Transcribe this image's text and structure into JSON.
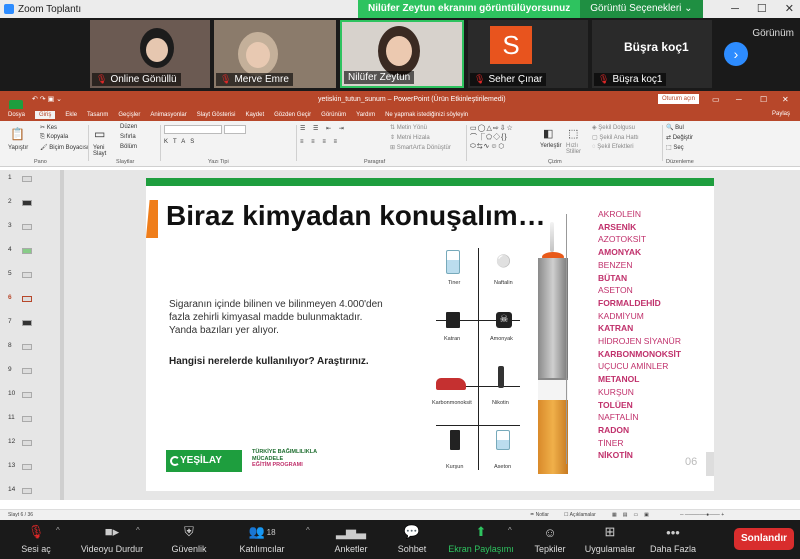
{
  "window": {
    "title": "Zoom Toplantı"
  },
  "share_banner": {
    "status": "Nilüfer Zeytun ekranını görüntülüyorsunuz",
    "options": "Görüntü Seçenekleri"
  },
  "gallery": {
    "participants": [
      {
        "name": "Online Gönüllü"
      },
      {
        "name": "Merve Emre"
      },
      {
        "name": "Nilüfer Zeytun"
      },
      {
        "name": "Seher Çınar",
        "initial": "S"
      },
      {
        "name": "Büşra koç1",
        "label": "Büşra koç1"
      }
    ],
    "view_label": "Görünüm"
  },
  "ppt": {
    "filename": "yetiskin_tutun_sunum  –  PowerPoint (Ürün Etkinleştirilemedi)",
    "signin": "Oturum açın",
    "tabs": [
      "Dosya",
      "Giriş",
      "Ekle",
      "Tasarım",
      "Geçişler",
      "Animasyonlar",
      "Slayt Gösterisi",
      "Kaydet",
      "Gözden Geçir",
      "Görünüm",
      "Yardım",
      "Ne yapmak istediğinizi söyleyin"
    ],
    "share": "Paylaş",
    "ribbon": {
      "clipboard": {
        "paste": "Yapıştır",
        "cut": "Kes",
        "copy": "Kopyala",
        "format": "Biçim Boyacısı",
        "group": "Pano"
      },
      "slides": {
        "new": "Yeni Slayt",
        "layout": "Düzen",
        "reset": "Sıfırla",
        "section": "Bölüm",
        "group": "Slaytlar"
      },
      "font_group": "Yazı Tipi",
      "paragraph": {
        "dir": "Metin Yönü",
        "align": "Metni Hizala",
        "smartart": "SmartArt'a Dönüştür",
        "group": "Paragraf"
      },
      "drawing": {
        "arrange": "Yerleştir",
        "styles": "Hızlı Stiller",
        "fill": "Şekil Dolgusu",
        "outline": "Şekil Ana Hattı",
        "effects": "Şekil Efektleri",
        "group": "Çizim"
      },
      "editing": {
        "find": "Bul",
        "replace": "Değiştir",
        "select": "Seç",
        "group": "Düzenleme"
      }
    },
    "slide_numbers": [
      "1",
      "2",
      "3",
      "4",
      "5",
      "6",
      "7",
      "8",
      "9",
      "10",
      "11",
      "12",
      "13",
      "14"
    ],
    "status": {
      "slide": "Slayt 6 / 36",
      "notes": "Notlar",
      "comments": "Açıklamalar"
    }
  },
  "slide": {
    "title": "Biraz kimyadan konuşalım…",
    "paragraph": "Sigaranın içinde bilinen ve bilinmeyen 4.000'den fazla zehirli kimyasal madde bulunmaktadır. Yanda bazıları yer alıyor.",
    "question": "Hangisi nerelerde kullanılıyor? Araştırınız.",
    "icons": [
      "Tiner",
      "Naftalin",
      "Katran",
      "Amonyak",
      "Karbonmonoksit",
      "Nikotin",
      "Kurşun",
      "Aseton"
    ],
    "chemicals": [
      {
        "name": "AKROLEİN",
        "bold": false
      },
      {
        "name": "ARSENİK",
        "bold": true
      },
      {
        "name": "AZOTOKSİT",
        "bold": false
      },
      {
        "name": "AMONYAK",
        "bold": true
      },
      {
        "name": "BENZEN",
        "bold": false
      },
      {
        "name": "BÜTAN",
        "bold": true
      },
      {
        "name": "ASETON",
        "bold": false
      },
      {
        "name": "FORMALDEHİD",
        "bold": true
      },
      {
        "name": "KADMİYUM",
        "bold": false
      },
      {
        "name": "KATRAN",
        "bold": true
      },
      {
        "name": "HİDROJEN SİYANÜR",
        "bold": false
      },
      {
        "name": "KARBONMONOKSİT",
        "bold": true
      },
      {
        "name": "UÇUCU AMİNLER",
        "bold": false
      },
      {
        "name": "METANOL",
        "bold": true
      },
      {
        "name": "KURŞUN",
        "bold": false
      },
      {
        "name": "TOLÜEN",
        "bold": true
      },
      {
        "name": "NAFTALİN",
        "bold": false
      },
      {
        "name": "RADON",
        "bold": true
      },
      {
        "name": "TİNER",
        "bold": false
      },
      {
        "name": "NİKOTİN",
        "bold": true
      }
    ],
    "logo": "YEŞİLAY",
    "program_line1": "TÜRKİYE BAĞIMLILIKLA",
    "program_line2": "MÜCADELE",
    "program_line3": "EĞİTİM PROGRAMI",
    "page_number": "06"
  },
  "toolbar": {
    "unmute": "Sesi aç",
    "video": "Videoyu Durdur",
    "security": "Güvenlik",
    "participants": "Katılımcılar",
    "participants_count": "18",
    "polls": "Anketler",
    "chat": "Sohbet",
    "share": "Ekran Paylaşımı",
    "reactions": "Tepkiler",
    "apps": "Uygulamalar",
    "more": "Daha Fazla",
    "end": "Sonlandır"
  },
  "colors": {
    "zoom_blue": "#2d8cff",
    "ppt_red": "#b7472a",
    "share_green": "#2ec35f",
    "chem_pink": "#c0306b",
    "yesilay_green": "#1e9e3e",
    "end_red": "#d92d2d"
  }
}
